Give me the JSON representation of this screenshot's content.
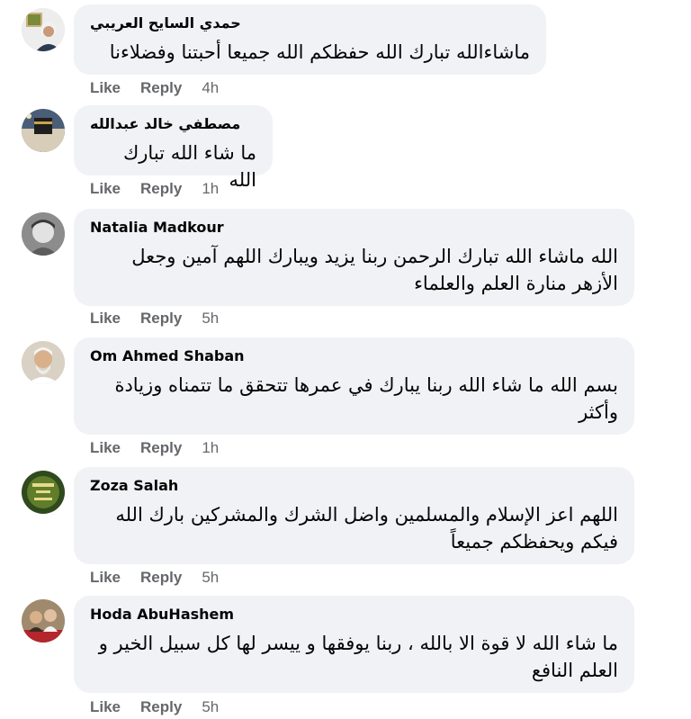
{
  "comments": [
    {
      "author": "حمدي السايح العريبي",
      "text": "ماشاءالله تبارك الله حفظكم الله جميعا أحبتنا وفضلاءنا",
      "like": "Like",
      "reply": "Reply",
      "time": "4h"
    },
    {
      "author": "مصطفي خالد عبدالله",
      "text": "ما شاء الله تبارك الله",
      "like": "Like",
      "reply": "Reply",
      "time": "1h"
    },
    {
      "author": "Natalia Madkour",
      "text": "الله ماشاء الله تبارك الرحمن ربنا يزيد ويبارك اللهم آمين وجعل الأزهر منارة العلم والعلماء",
      "like": "Like",
      "reply": "Reply",
      "time": "5h"
    },
    {
      "author": "Om Ahmed Shaban",
      "text": "بسم الله ما شاء الله ربنا يبارك في عمرها تتحقق ما تتمناه وزيادة وأكثر",
      "like": "Like",
      "reply": "Reply",
      "time": "1h"
    },
    {
      "author": "Zoza Salah",
      "text": "اللهم اعز الإسلام والمسلمين واضل الشرك والمشركين بارك الله فيكم ويحفظكم جميعاً",
      "like": "Like",
      "reply": "Reply",
      "time": "5h"
    },
    {
      "author": "Hoda AbuHashem",
      "text": "ما شاء الله لا قوة الا بالله ، ربنا يوفقها و ييسر لها كل سبيل الخير و العلم النافع",
      "like": "Like",
      "reply": "Reply",
      "time": "5h"
    }
  ]
}
